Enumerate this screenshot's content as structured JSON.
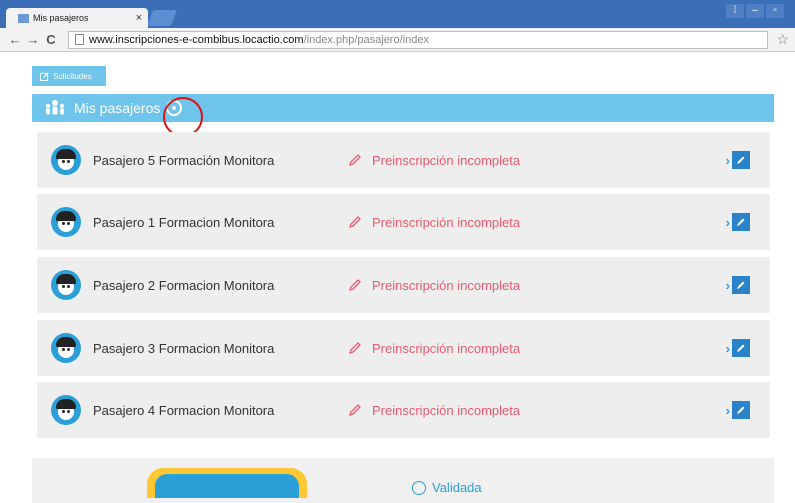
{
  "browser": {
    "tab_title": "Mis pasajeros",
    "tab_close": "×",
    "back": "←",
    "forward": "→",
    "reload": "C",
    "url_host": "www.inscripciones-e-combibus.locactio.com",
    "url_path": "/index.php/pasajero/index",
    "star": "☆"
  },
  "page": {
    "solicitudes_label": "Solicitudes",
    "header_title": "Mis pasajeros",
    "passengers": [
      {
        "name": "Pasajero 5 Formación Monitora",
        "status": "Preinscripción incompleta"
      },
      {
        "name": "Pasajero 1 Formacion Monitora",
        "status": "Preinscripción incompleta"
      },
      {
        "name": "Pasajero 2 Formacion Monitora",
        "status": "Preinscripción incompleta"
      },
      {
        "name": "Pasajero 3 Formacion Monitora",
        "status": "Preinscripción incompleta"
      },
      {
        "name": "Pasajero 4 Formacion Monitora",
        "status": "Preinscripción incompleta"
      }
    ],
    "validada_label": "Validada"
  },
  "colors": {
    "accent": "#6ec4ea",
    "status_red": "#e85a6f",
    "edit_blue": "#2a82c8"
  }
}
